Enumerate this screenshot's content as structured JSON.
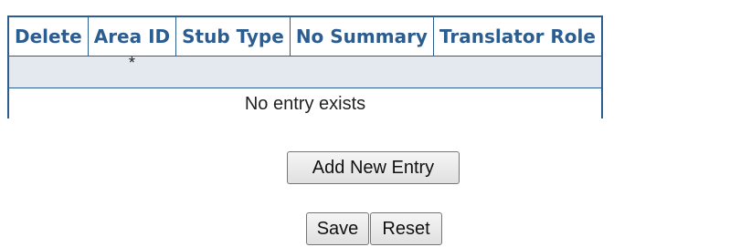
{
  "table": {
    "columns": [
      "Delete",
      "Area ID",
      "Stub Type",
      "No Summary",
      "Translator Role"
    ],
    "new_row_marker": "*",
    "empty_message": "No entry exists"
  },
  "buttons": {
    "add_new_entry": "Add New Entry",
    "save": "Save",
    "reset": "Reset"
  },
  "colors": {
    "table_border": "#2c5d91",
    "header_text": "#2c5d91",
    "new_row_background": "#e4e8ef"
  }
}
